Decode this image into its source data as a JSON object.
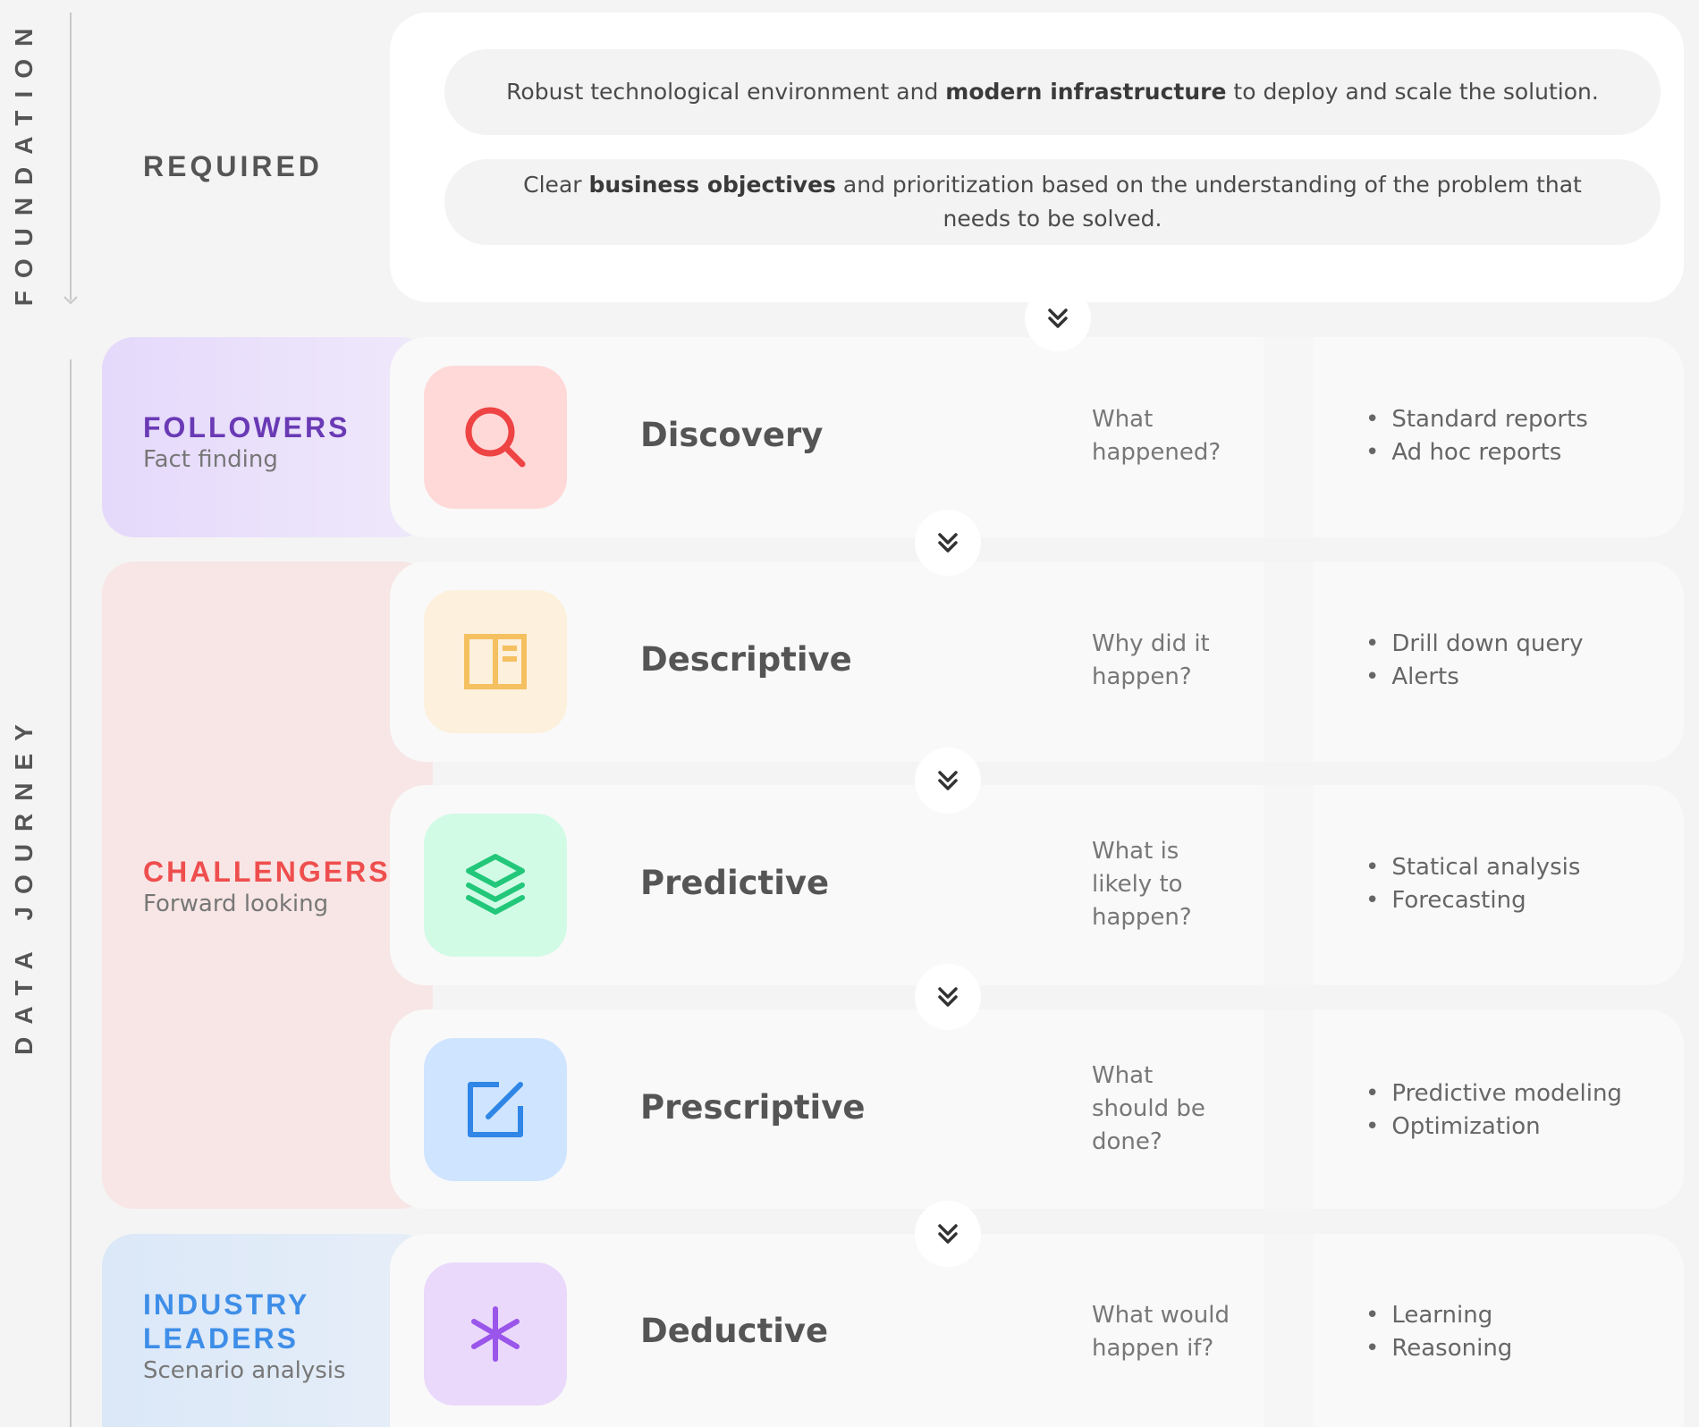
{
  "side_labels": {
    "foundation": "FOUNDATION",
    "journey": "DATA JOURNEY"
  },
  "foundation": {
    "required_label": "REQUIRED",
    "items": [
      {
        "pre": "Robust technological environment and ",
        "bold": "modern infrastructure",
        "post": " to deploy and scale the solution."
      },
      {
        "pre": "Clear ",
        "bold": "business objectives",
        "post": " and prioritization based on the understanding of the problem that needs to be solved."
      }
    ]
  },
  "tiers": [
    {
      "name": "FOLLOWERS",
      "sub": "Fact finding",
      "color": "#6a3ab5"
    },
    {
      "name": "CHALLENGERS",
      "sub": "Forward looking",
      "color": "#ef4e4e"
    },
    {
      "name": "INDUSTRY\nLEADERS",
      "sub": "Scenario analysis",
      "color": "#3e8ee8"
    }
  ],
  "rows": [
    {
      "title": "Discovery",
      "question": "What\nhappened?",
      "bullets": [
        "Standard reports",
        "Ad hoc reports"
      ],
      "icon": "search-icon",
      "icon_color": "#ee4444",
      "icon_bg": "#ffd9d8"
    },
    {
      "title": "Descriptive",
      "question": "Why did it\nhappen?",
      "bullets": [
        "Drill down query",
        "Alerts"
      ],
      "icon": "panel-icon",
      "icon_color": "#f5c060",
      "icon_bg": "#fdf0dc"
    },
    {
      "title": "Predictive",
      "question": "What is\nlikely to\nhappen?",
      "bullets": [
        "Statical analysis",
        "Forecasting"
      ],
      "icon": "layers-icon",
      "icon_color": "#22c77a",
      "icon_bg": "#d2fbe6"
    },
    {
      "title": "Prescriptive",
      "question": "What\nshould be\ndone?",
      "bullets": [
        "Predictive modeling",
        "Optimization"
      ],
      "icon": "edit-icon",
      "icon_color": "#2f86e6",
      "icon_bg": "#cfe4ff"
    },
    {
      "title": "Deductive",
      "question": "What would\nhappen if?",
      "bullets": [
        "Learning",
        "Reasoning"
      ],
      "icon": "asterisk-icon",
      "icon_color": "#9a55ea",
      "icon_bg": "#ead9fb"
    }
  ],
  "colors": {
    "background": "#f4f4f4",
    "card": "#ffffff",
    "text": "#555555"
  }
}
